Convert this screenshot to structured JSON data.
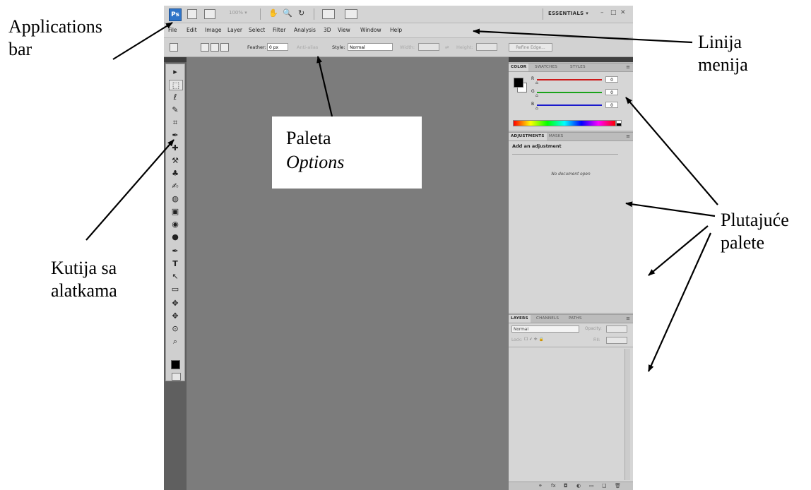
{
  "annotations": {
    "applications_bar": [
      "Applications",
      "bar"
    ],
    "linija_menija": [
      "Linija",
      "menija"
    ],
    "paleta_options": {
      "line1": "Paleta",
      "line2": "Options"
    },
    "kutija_sa_alatkama": [
      "Kutija sa",
      "alatkama"
    ],
    "plutajuce_palete": [
      "Plutajuće",
      "palete"
    ]
  },
  "app_bar": {
    "logo": "Ps",
    "zoom": "100% ▾",
    "workspace": "ESSENTIALS ▾",
    "window_controls": [
      "–",
      "□",
      "✕"
    ]
  },
  "menu": [
    "File",
    "Edit",
    "Image",
    "Layer",
    "Select",
    "Filter",
    "Analysis",
    "3D",
    "View",
    "Window",
    "Help"
  ],
  "options_bar": {
    "feather_label": "Feather:",
    "feather_value": "0 px",
    "anti_alias": "Anti-alias",
    "style_label": "Style:",
    "style_value": "Normal",
    "width_label": "Width:",
    "height_label": "Height:",
    "refine_edge": "Refine Edge..."
  },
  "tools": [
    "▸",
    "⬚",
    "ℓ",
    "✎",
    "⌗",
    "✒",
    "✚",
    "⚒",
    "♣",
    "✍",
    "◍",
    "▣",
    "◉",
    "●",
    "✒",
    "T",
    "↖",
    "▭",
    "✥",
    "✥",
    "⊙",
    "⌕"
  ],
  "color_panel": {
    "tabs": [
      "COLOR",
      "SWATCHES",
      "STYLES"
    ],
    "channels": [
      {
        "label": "R",
        "value": "0",
        "color": "#cc1a1a"
      },
      {
        "label": "G",
        "value": "0",
        "color": "#1aa31a"
      },
      {
        "label": "B",
        "value": "0",
        "color": "#1a1acc"
      }
    ]
  },
  "adjustments_panel": {
    "tabs": [
      "ADJUSTMENTS",
      "MASKS"
    ],
    "title": "Add an adjustment",
    "message": "No document open"
  },
  "layers_panel": {
    "tabs": [
      "LAYERS",
      "CHANNELS",
      "PATHS"
    ],
    "blend_mode": "Normal",
    "opacity_label": "Opacity:",
    "lock_label": "Lock:",
    "lock_icons": "☐ ✓ ✛ 🔒",
    "fill_label": "Fill:",
    "bottom_icons": [
      "⚭",
      "fx",
      "◘",
      "◐",
      "▭",
      "❑",
      "🗑"
    ]
  },
  "colors": {
    "canvas": "#7c7c7c",
    "chrome": "#d4d4d4",
    "accent": "#2f74c8"
  }
}
